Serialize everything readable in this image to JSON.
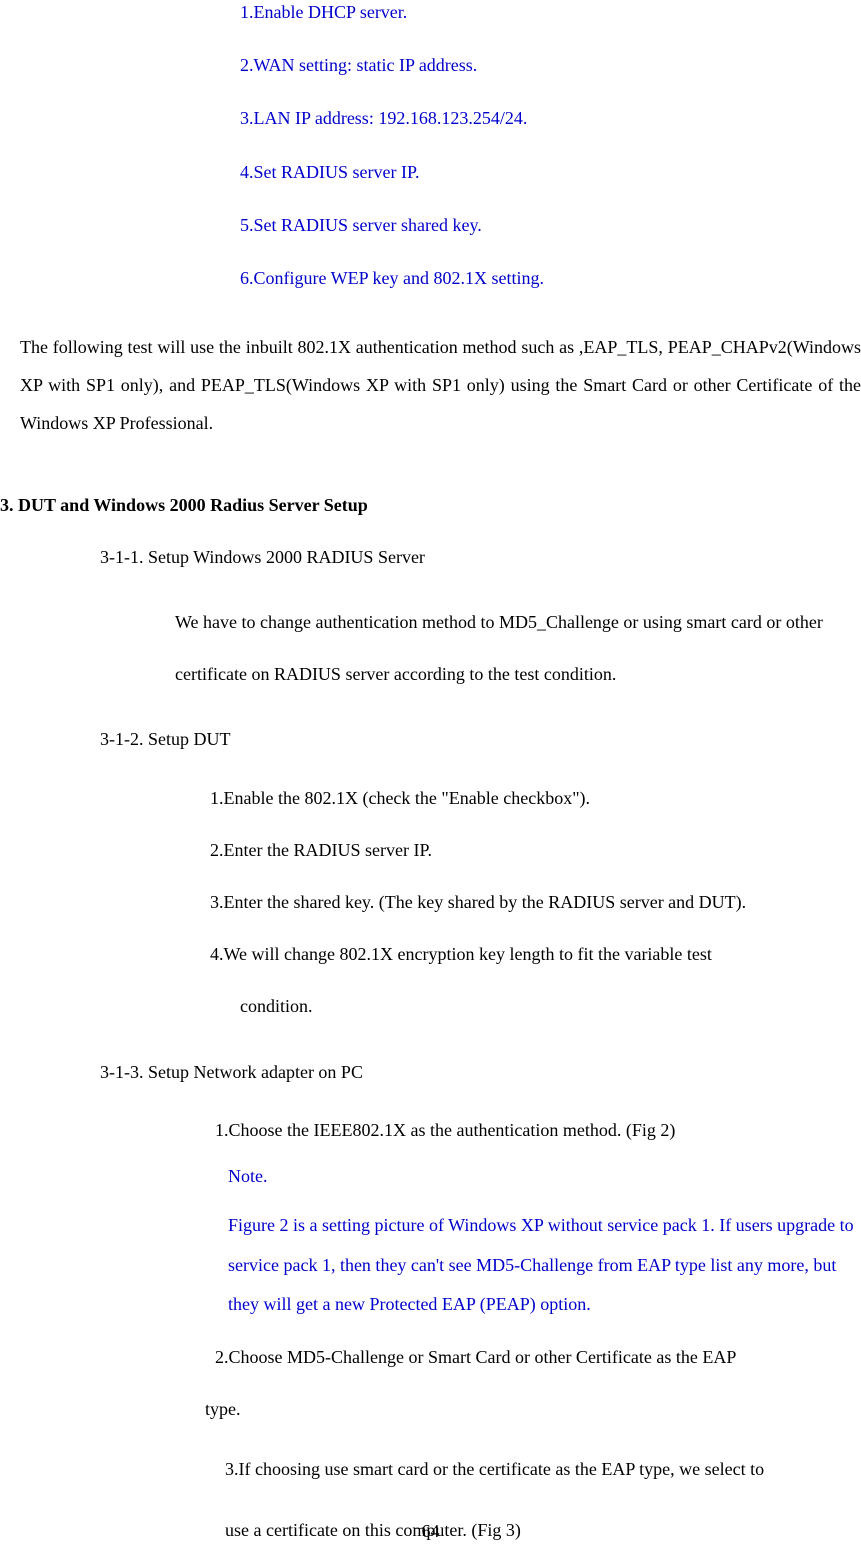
{
  "steps_top": {
    "s1": "1.Enable DHCP server.",
    "s2": "2.WAN setting: static IP address.",
    "s3": "3.LAN IP address: 192.168.123.254/24.",
    "s4": "4.Set RADIUS server IP.",
    "s5": "5.Set RADIUS server shared key.",
    "s6": "6.Configure WEP key and 802.1X setting."
  },
  "paragraph": "The following test will use the inbuilt 802.1X authentication method such as ,EAP_TLS, PEAP_CHAPv2(Windows XP with SP1 only), and PEAP_TLS(Windows XP with SP1 only) using the Smart Card or other Certificate of the Windows XP Professional.",
  "section3": {
    "heading": "3. DUT and Windows 2000 Radius Server Setup",
    "s311_title": "3-1-1.   Setup Windows 2000 RADIUS Server",
    "s311_body": "We have to change authentication method to MD5_Challenge or using smart card or other certificate on RADIUS server according to the test condition.",
    "s312_title": "3-1-2.   Setup DUT",
    "s312_1": "1.Enable the 802.1X (check the \"Enable checkbox\").",
    "s312_2": "2.Enter the RADIUS server IP.",
    "s312_3": "3.Enter the shared key. (The key shared by the RADIUS server and DUT).",
    "s312_4a": "4.We will change 802.1X encryption key length to fit the variable test",
    "s312_4b": "condition.",
    "s313_title": "3-1-3.   Setup Network adapter on PC",
    "s313_1": "1.Choose the IEEE802.1X as the authentication method. (Fig 2)",
    "s313_note_label": "Note.",
    "s313_note": "Figure 2 is a setting picture of Windows XP without service pack 1. If users upgrade to service pack 1, then they can't see MD5-Challenge from EAP type list any more, but they will get a new Protected EAP (PEAP) option.",
    "s313_2a": "2.Choose MD5-Challenge or Smart Card or other Certificate as the EAP",
    "s313_2b": "type.",
    "s313_3a": "3.If choosing use smart card or the certificate as the EAP type, we select to",
    "s313_3b": "use a certificate on this computer. (Fig 3)"
  },
  "page_number": "64"
}
